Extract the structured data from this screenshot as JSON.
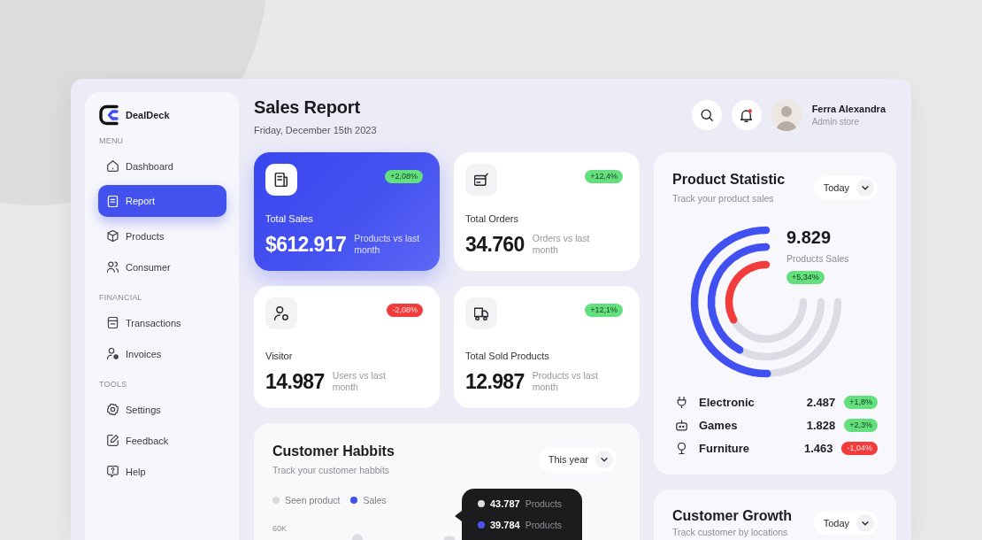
{
  "sidebar": {
    "brand": "DealDeck",
    "sections": [
      {
        "heading": "MENU",
        "items": [
          {
            "label": "Dashboard",
            "selected": false
          },
          {
            "label": "Report",
            "selected": true
          },
          {
            "label": "Products",
            "selected": false
          },
          {
            "label": "Consumer",
            "selected": false
          }
        ]
      },
      {
        "heading": "FINANCIAL",
        "items": [
          {
            "label": "Transactions",
            "selected": false
          },
          {
            "label": "Invoices",
            "selected": false
          }
        ]
      },
      {
        "heading": "TOOLS",
        "items": [
          {
            "label": "Settings",
            "selected": false
          },
          {
            "label": "Feedback",
            "selected": false
          },
          {
            "label": "Help",
            "selected": false
          }
        ]
      }
    ]
  },
  "header": {
    "title": "Sales Report",
    "date": "Friday, December 15th 2023",
    "unread": true,
    "user": {
      "name": "Ferra Alexandra",
      "role": "Admin store"
    }
  },
  "stats": [
    {
      "label": "Total Sales",
      "value": "$612.917",
      "note": "Products vs last month",
      "change": "+2,08%",
      "negative": false,
      "highlighted": true
    },
    {
      "label": "Total Orders",
      "value": "34.760",
      "note": "Orders vs last month",
      "change": "+12,4%",
      "negative": false,
      "highlighted": false
    },
    {
      "label": "Visitor",
      "value": "14.987",
      "note": "Users vs last month",
      "change": "-2,08%",
      "negative": true,
      "highlighted": false
    },
    {
      "label": "Total Sold Products",
      "value": "12.987",
      "note": "Products vs last month",
      "change": "+12,1%",
      "negative": false,
      "highlighted": false
    }
  ],
  "customer_habits": {
    "title": "Customer Habbits",
    "subtitle": "Track your customer habbits",
    "period": "This year",
    "legend": [
      {
        "label": "Seen product",
        "color": "#d9d9df"
      },
      {
        "label": "Sales",
        "color": "#4150f0"
      }
    ],
    "y_tick": "60K",
    "tooltip": [
      {
        "value": "43.787",
        "unit": "Products",
        "color": "#dedee3"
      },
      {
        "value": "39.784",
        "unit": "Products",
        "color": "#4a55f3"
      }
    ]
  },
  "product_statistic": {
    "title": "Product Statistic",
    "subtitle": "Track your product sales",
    "period": "Today",
    "total": "9.829",
    "total_label": "Products Sales",
    "change": "+5,34%",
    "negative": false,
    "categories": [
      {
        "name": "Electronic",
        "value": "2.487",
        "change": "+1,8%",
        "negative": false
      },
      {
        "name": "Games",
        "value": "1.828",
        "change": "+2,3%",
        "negative": false
      },
      {
        "name": "Furniture",
        "value": "1.463",
        "change": "-1,04%",
        "negative": true
      }
    ]
  },
  "customer_growth": {
    "title": "Customer Growth",
    "subtitle": "Track customer by locations",
    "period": "Today"
  }
}
